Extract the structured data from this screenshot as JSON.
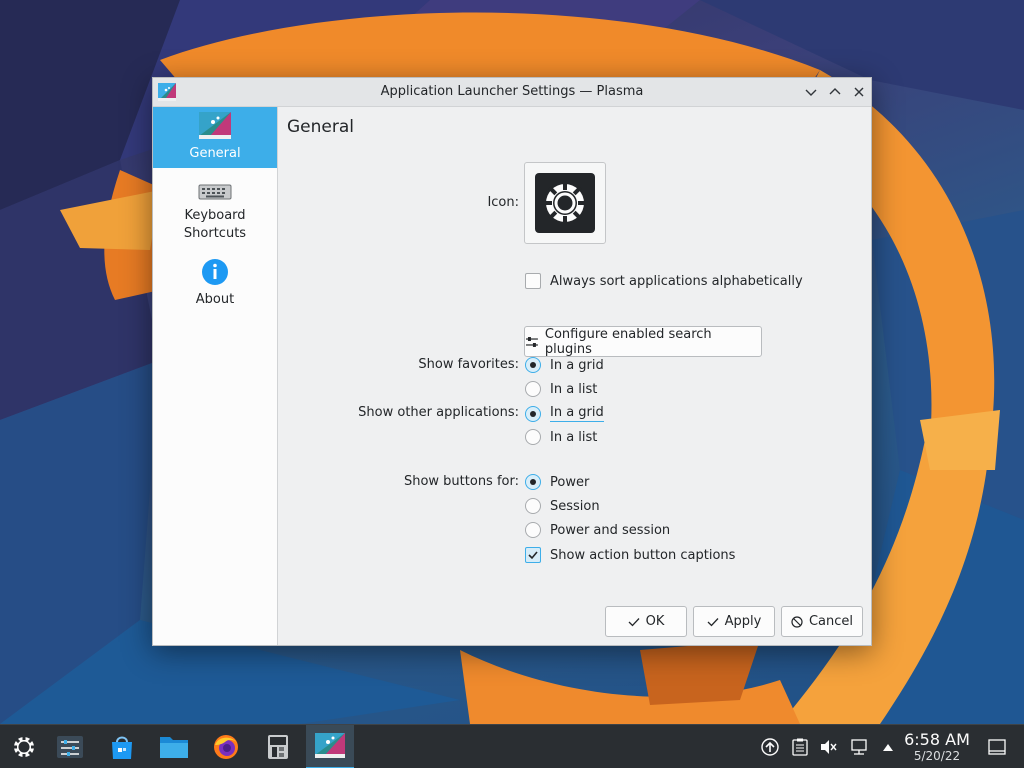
{
  "window": {
    "title": "Application Launcher Settings — Plasma"
  },
  "sidebar": {
    "items": [
      {
        "label": "General"
      },
      {
        "label": "Keyboard"
      },
      {
        "label": "Shortcuts"
      },
      {
        "label": "About"
      }
    ]
  },
  "page": {
    "title": "General",
    "icon_label": "Icon:",
    "sort_label": "Always sort applications alphabetically",
    "sort_checked": false,
    "plugins_button": "Configure enabled search plugins",
    "favorites": {
      "label": "Show favorites:",
      "options": [
        "In a grid",
        "In a list"
      ],
      "selected": "In a grid"
    },
    "other_apps": {
      "label": "Show other applications:",
      "options": [
        "In a grid",
        "In a list"
      ],
      "selected": "In a grid"
    },
    "buttons_for": {
      "label": "Show buttons for:",
      "options": [
        "Power",
        "Session",
        "Power and session"
      ],
      "selected": "Power"
    },
    "captions_label": "Show action button captions",
    "captions_checked": true
  },
  "footer": {
    "ok": "OK",
    "apply": "Apply",
    "cancel": "Cancel"
  },
  "taskbar": {
    "time": "6:58 AM",
    "date": "5/20/22"
  },
  "colors": {
    "accent": "#3daee9",
    "window_bg": "#eff0f1",
    "taskbar_bg": "#2a2e32"
  }
}
